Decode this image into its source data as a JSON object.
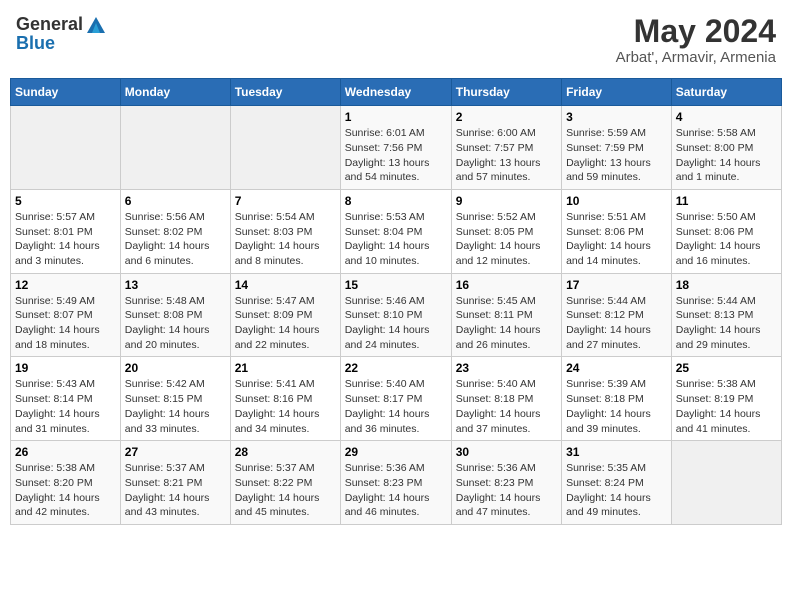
{
  "header": {
    "logo_general": "General",
    "logo_blue": "Blue",
    "title": "May 2024",
    "subtitle": "Arbat', Armavir, Armenia"
  },
  "weekdays": [
    "Sunday",
    "Monday",
    "Tuesday",
    "Wednesday",
    "Thursday",
    "Friday",
    "Saturday"
  ],
  "weeks": [
    [
      {
        "day": "",
        "sunrise": "",
        "sunset": "",
        "daylight": ""
      },
      {
        "day": "",
        "sunrise": "",
        "sunset": "",
        "daylight": ""
      },
      {
        "day": "",
        "sunrise": "",
        "sunset": "",
        "daylight": ""
      },
      {
        "day": "1",
        "sunrise": "Sunrise: 6:01 AM",
        "sunset": "Sunset: 7:56 PM",
        "daylight": "Daylight: 13 hours and 54 minutes."
      },
      {
        "day": "2",
        "sunrise": "Sunrise: 6:00 AM",
        "sunset": "Sunset: 7:57 PM",
        "daylight": "Daylight: 13 hours and 57 minutes."
      },
      {
        "day": "3",
        "sunrise": "Sunrise: 5:59 AM",
        "sunset": "Sunset: 7:59 PM",
        "daylight": "Daylight: 13 hours and 59 minutes."
      },
      {
        "day": "4",
        "sunrise": "Sunrise: 5:58 AM",
        "sunset": "Sunset: 8:00 PM",
        "daylight": "Daylight: 14 hours and 1 minute."
      }
    ],
    [
      {
        "day": "5",
        "sunrise": "Sunrise: 5:57 AM",
        "sunset": "Sunset: 8:01 PM",
        "daylight": "Daylight: 14 hours and 3 minutes."
      },
      {
        "day": "6",
        "sunrise": "Sunrise: 5:56 AM",
        "sunset": "Sunset: 8:02 PM",
        "daylight": "Daylight: 14 hours and 6 minutes."
      },
      {
        "day": "7",
        "sunrise": "Sunrise: 5:54 AM",
        "sunset": "Sunset: 8:03 PM",
        "daylight": "Daylight: 14 hours and 8 minutes."
      },
      {
        "day": "8",
        "sunrise": "Sunrise: 5:53 AM",
        "sunset": "Sunset: 8:04 PM",
        "daylight": "Daylight: 14 hours and 10 minutes."
      },
      {
        "day": "9",
        "sunrise": "Sunrise: 5:52 AM",
        "sunset": "Sunset: 8:05 PM",
        "daylight": "Daylight: 14 hours and 12 minutes."
      },
      {
        "day": "10",
        "sunrise": "Sunrise: 5:51 AM",
        "sunset": "Sunset: 8:06 PM",
        "daylight": "Daylight: 14 hours and 14 minutes."
      },
      {
        "day": "11",
        "sunrise": "Sunrise: 5:50 AM",
        "sunset": "Sunset: 8:06 PM",
        "daylight": "Daylight: 14 hours and 16 minutes."
      }
    ],
    [
      {
        "day": "12",
        "sunrise": "Sunrise: 5:49 AM",
        "sunset": "Sunset: 8:07 PM",
        "daylight": "Daylight: 14 hours and 18 minutes."
      },
      {
        "day": "13",
        "sunrise": "Sunrise: 5:48 AM",
        "sunset": "Sunset: 8:08 PM",
        "daylight": "Daylight: 14 hours and 20 minutes."
      },
      {
        "day": "14",
        "sunrise": "Sunrise: 5:47 AM",
        "sunset": "Sunset: 8:09 PM",
        "daylight": "Daylight: 14 hours and 22 minutes."
      },
      {
        "day": "15",
        "sunrise": "Sunrise: 5:46 AM",
        "sunset": "Sunset: 8:10 PM",
        "daylight": "Daylight: 14 hours and 24 minutes."
      },
      {
        "day": "16",
        "sunrise": "Sunrise: 5:45 AM",
        "sunset": "Sunset: 8:11 PM",
        "daylight": "Daylight: 14 hours and 26 minutes."
      },
      {
        "day": "17",
        "sunrise": "Sunrise: 5:44 AM",
        "sunset": "Sunset: 8:12 PM",
        "daylight": "Daylight: 14 hours and 27 minutes."
      },
      {
        "day": "18",
        "sunrise": "Sunrise: 5:44 AM",
        "sunset": "Sunset: 8:13 PM",
        "daylight": "Daylight: 14 hours and 29 minutes."
      }
    ],
    [
      {
        "day": "19",
        "sunrise": "Sunrise: 5:43 AM",
        "sunset": "Sunset: 8:14 PM",
        "daylight": "Daylight: 14 hours and 31 minutes."
      },
      {
        "day": "20",
        "sunrise": "Sunrise: 5:42 AM",
        "sunset": "Sunset: 8:15 PM",
        "daylight": "Daylight: 14 hours and 33 minutes."
      },
      {
        "day": "21",
        "sunrise": "Sunrise: 5:41 AM",
        "sunset": "Sunset: 8:16 PM",
        "daylight": "Daylight: 14 hours and 34 minutes."
      },
      {
        "day": "22",
        "sunrise": "Sunrise: 5:40 AM",
        "sunset": "Sunset: 8:17 PM",
        "daylight": "Daylight: 14 hours and 36 minutes."
      },
      {
        "day": "23",
        "sunrise": "Sunrise: 5:40 AM",
        "sunset": "Sunset: 8:18 PM",
        "daylight": "Daylight: 14 hours and 37 minutes."
      },
      {
        "day": "24",
        "sunrise": "Sunrise: 5:39 AM",
        "sunset": "Sunset: 8:18 PM",
        "daylight": "Daylight: 14 hours and 39 minutes."
      },
      {
        "day": "25",
        "sunrise": "Sunrise: 5:38 AM",
        "sunset": "Sunset: 8:19 PM",
        "daylight": "Daylight: 14 hours and 41 minutes."
      }
    ],
    [
      {
        "day": "26",
        "sunrise": "Sunrise: 5:38 AM",
        "sunset": "Sunset: 8:20 PM",
        "daylight": "Daylight: 14 hours and 42 minutes."
      },
      {
        "day": "27",
        "sunrise": "Sunrise: 5:37 AM",
        "sunset": "Sunset: 8:21 PM",
        "daylight": "Daylight: 14 hours and 43 minutes."
      },
      {
        "day": "28",
        "sunrise": "Sunrise: 5:37 AM",
        "sunset": "Sunset: 8:22 PM",
        "daylight": "Daylight: 14 hours and 45 minutes."
      },
      {
        "day": "29",
        "sunrise": "Sunrise: 5:36 AM",
        "sunset": "Sunset: 8:23 PM",
        "daylight": "Daylight: 14 hours and 46 minutes."
      },
      {
        "day": "30",
        "sunrise": "Sunrise: 5:36 AM",
        "sunset": "Sunset: 8:23 PM",
        "daylight": "Daylight: 14 hours and 47 minutes."
      },
      {
        "day": "31",
        "sunrise": "Sunrise: 5:35 AM",
        "sunset": "Sunset: 8:24 PM",
        "daylight": "Daylight: 14 hours and 49 minutes."
      },
      {
        "day": "",
        "sunrise": "",
        "sunset": "",
        "daylight": ""
      }
    ]
  ]
}
